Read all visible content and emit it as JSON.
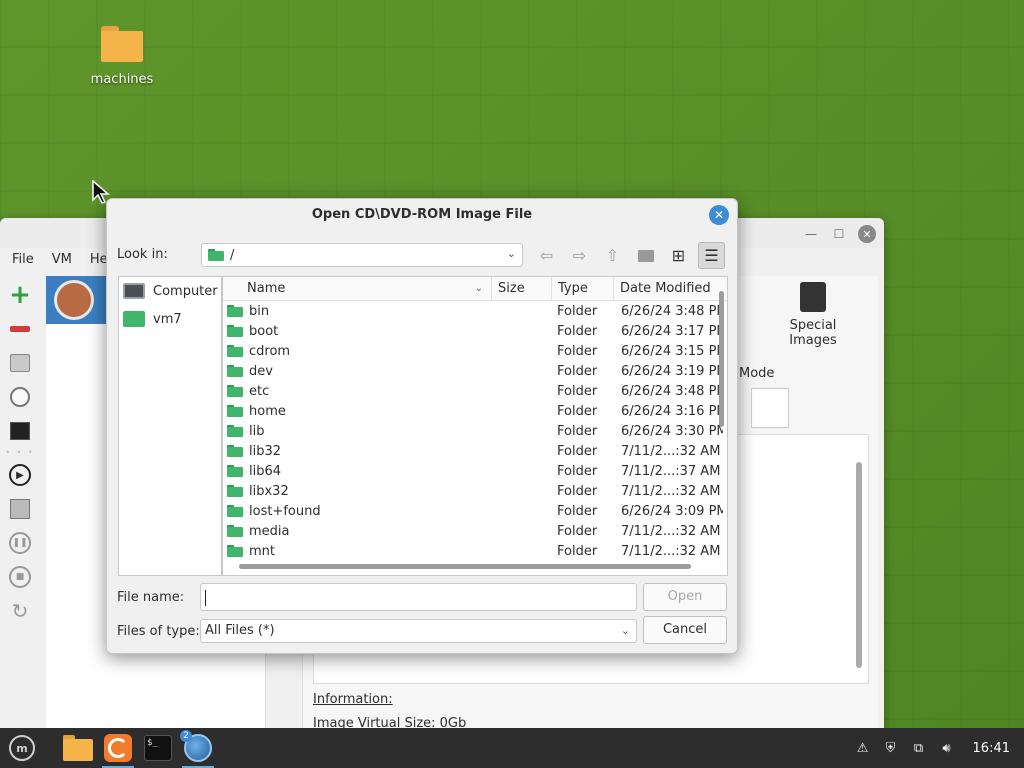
{
  "desktop": {
    "icons": [
      {
        "label": "machines",
        "icon": "folder-icon"
      }
    ]
  },
  "vbox_window": {
    "menu": [
      "File",
      "VM",
      "He"
    ],
    "special_images_label": "Special Images",
    "mode_label": "Mode",
    "information_label": "Information:",
    "image_virtual_size": "Image Virtual Size: 0Gb"
  },
  "dialog": {
    "title": "Open CD\\DVD-ROM Image File",
    "look_in_label": "Look in:",
    "look_in_value": "/",
    "places": [
      {
        "label": "Computer",
        "icon": "computer-icon"
      },
      {
        "label": "vm7",
        "icon": "folder-icon"
      }
    ],
    "columns": {
      "name": "Name",
      "size": "Size",
      "type": "Type",
      "date": "Date Modified"
    },
    "files": [
      {
        "name": "bin",
        "size": "",
        "type": "Folder",
        "date": "6/26/24 3:48 PM"
      },
      {
        "name": "boot",
        "size": "",
        "type": "Folder",
        "date": "6/26/24 3:17 PM"
      },
      {
        "name": "cdrom",
        "size": "",
        "type": "Folder",
        "date": "6/26/24 3:15 PM"
      },
      {
        "name": "dev",
        "size": "",
        "type": "Folder",
        "date": "6/26/24 3:19 PM"
      },
      {
        "name": "etc",
        "size": "",
        "type": "Folder",
        "date": "6/26/24 3:48 PM"
      },
      {
        "name": "home",
        "size": "",
        "type": "Folder",
        "date": "6/26/24 3:16 PM"
      },
      {
        "name": "lib",
        "size": "",
        "type": "Folder",
        "date": "6/26/24 3:30 PM"
      },
      {
        "name": "lib32",
        "size": "",
        "type": "Folder",
        "date": "7/11/2...:32 AM"
      },
      {
        "name": "lib64",
        "size": "",
        "type": "Folder",
        "date": "7/11/2...:37 AM"
      },
      {
        "name": "libx32",
        "size": "",
        "type": "Folder",
        "date": "7/11/2...:32 AM"
      },
      {
        "name": "lost+found",
        "size": "",
        "type": "Folder",
        "date": "6/26/24 3:09 PM"
      },
      {
        "name": "media",
        "size": "",
        "type": "Folder",
        "date": "7/11/2...:32 AM"
      },
      {
        "name": "mnt",
        "size": "",
        "type": "Folder",
        "date": "7/11/2...:32 AM"
      }
    ],
    "file_name_label": "File name:",
    "file_name_value": "",
    "files_of_type_label": "Files of type:",
    "files_of_type_value": "All Files (*)",
    "open_button": "Open",
    "cancel_button": "Cancel"
  },
  "taskbar": {
    "apps": [
      "mint-menu-icon",
      "files-icon",
      "firefox-icon",
      "terminal-icon",
      "virtualbox-icon"
    ],
    "virtualbox_badge": "2",
    "clock": "16:41"
  }
}
